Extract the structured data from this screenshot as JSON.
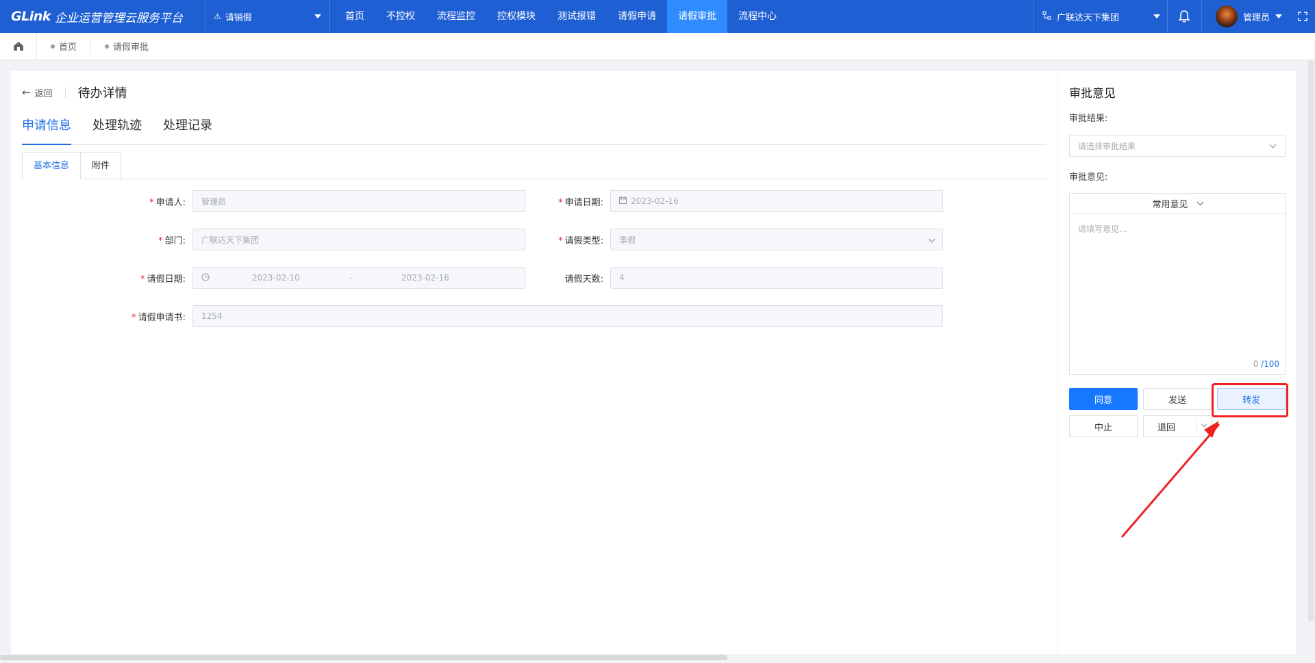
{
  "topbar": {
    "logo": "GLink",
    "brand_name": "企业运营管理云服务平台",
    "app_selector": "请销假",
    "nav": [
      "首页",
      "不控权",
      "流程监控",
      "控权模块",
      "测试报错",
      "请假申请",
      "请假审批",
      "流程中心"
    ],
    "active_nav": "请假审批",
    "org": "广联达天下集团",
    "user": "管理员"
  },
  "breadcrumb": [
    "首页",
    "请假审批"
  ],
  "page": {
    "back_label": "返回",
    "title": "待办详情",
    "tabs": [
      "申请信息",
      "处理轨迹",
      "处理记录"
    ],
    "subtabs": [
      "基本信息",
      "附件"
    ]
  },
  "form": {
    "applicant": {
      "label": "申请人:",
      "value": "管理员"
    },
    "apply_date": {
      "label": "申请日期:",
      "value": "2023-02-16"
    },
    "department": {
      "label": "部门:",
      "value": "广联达天下集团"
    },
    "leave_type": {
      "label": "请假类型:",
      "value": "事假"
    },
    "leave_dates": {
      "label": "请假日期:",
      "start": "2023-02-10",
      "sep": "-",
      "end": "2023-02-16"
    },
    "leave_days": {
      "label": "请假天数:",
      "value": "4"
    },
    "leave_letter": {
      "label": "请假申请书:",
      "value": "1254"
    }
  },
  "approval": {
    "title": "审批意见",
    "result_label": "审批结果:",
    "result_placeholder": "请选择审批结果",
    "opinion_label": "审批意见:",
    "common_opinion": "常用意见",
    "opinion_placeholder": "请填写意见...",
    "count": "0",
    "max": "/100",
    "buttons": {
      "agree": "同意",
      "send": "发送",
      "forward": "转发",
      "stop": "中止",
      "return": "退回"
    }
  },
  "colors": {
    "topbar": "#1f5fd4",
    "active_nav": "#2f8cff",
    "primary": "#1677ff",
    "annotation": "#ee2222"
  }
}
